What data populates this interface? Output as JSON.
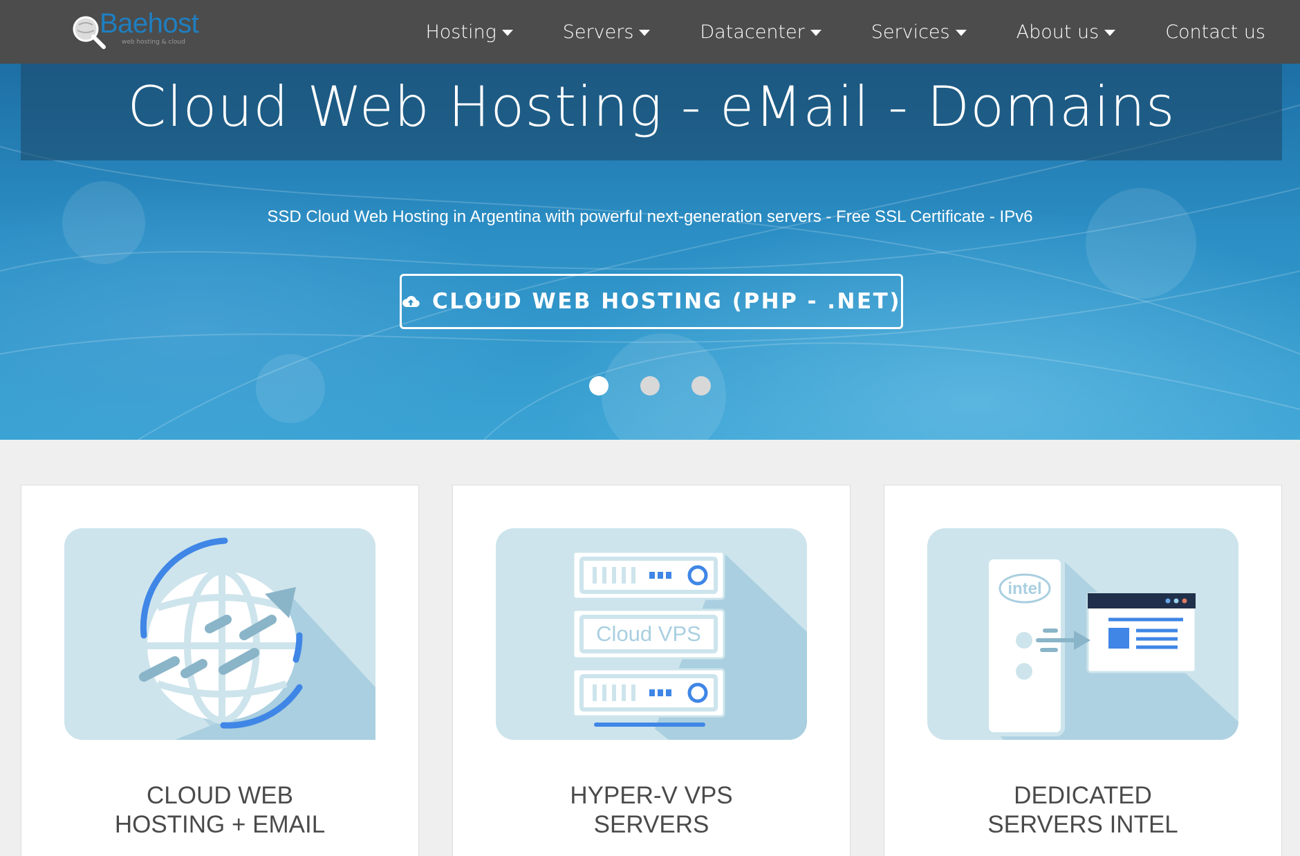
{
  "brand": {
    "name": "Baehost",
    "tagline": "web hosting & cloud"
  },
  "nav": {
    "items": [
      {
        "label": "Hosting",
        "has_dropdown": true
      },
      {
        "label": "Servers",
        "has_dropdown": true
      },
      {
        "label": "Datacenter",
        "has_dropdown": true
      },
      {
        "label": "Services",
        "has_dropdown": true
      },
      {
        "label": "About us",
        "has_dropdown": true
      },
      {
        "label": "Contact us",
        "has_dropdown": false
      }
    ]
  },
  "hero": {
    "title": "Cloud Web Hosting - eMail - Domains",
    "subtitle": "SSD Cloud Web Hosting in Argentina with powerful next-generation servers - Free SSL Certificate - IPv6",
    "cta_label": "CLOUD WEB HOSTING (PHP - .NET)",
    "cta_icon": "cloud-upload-icon",
    "slides": 3,
    "active_slide": 1
  },
  "cards": [
    {
      "title_line1": "CLOUD WEB",
      "title_line2": "HOSTING + EMAIL",
      "icon": "globe-icon"
    },
    {
      "title_line1": "HYPER-V VPS",
      "title_line2": "SERVERS",
      "icon": "server-rack-icon",
      "image_label": "Cloud VPS"
    },
    {
      "title_line1": "DEDICATED",
      "title_line2": "SERVERS INTEL",
      "icon": "intel-server-icon",
      "image_label": "intel"
    }
  ],
  "colors": {
    "nav_bg": "#4c4c4c",
    "brand_blue": "#1f7fc1",
    "hero_blue": "#2b8ec4",
    "illustration_bg": "#cde4ec",
    "illustration_accent": "#3f86e6"
  }
}
